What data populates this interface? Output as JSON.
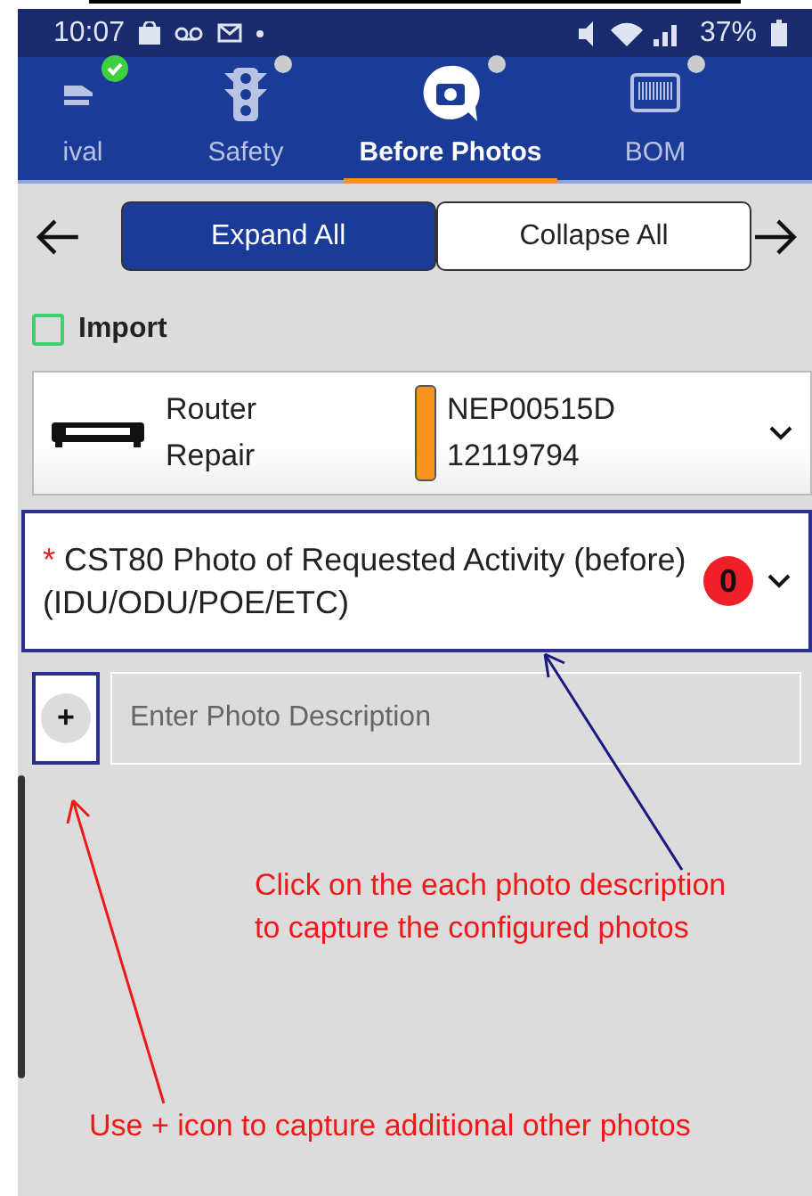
{
  "status_bar": {
    "time": "10:07",
    "battery": "37%"
  },
  "tabs": [
    {
      "label": "ival",
      "selected": false,
      "done": true,
      "kind": "arrival"
    },
    {
      "label": "Safety",
      "selected": false,
      "done": false,
      "kind": "traffic"
    },
    {
      "label": "Before Photos",
      "selected": true,
      "done": false,
      "kind": "camera"
    },
    {
      "label": "BOM",
      "selected": false,
      "done": false,
      "kind": "barcode"
    }
  ],
  "buttons": [
    {
      "label": "Expand All",
      "selected": true
    },
    {
      "label": "Collapse All",
      "selected": false
    }
  ],
  "import": {
    "label": "Import",
    "checked": false
  },
  "device": {
    "name": "Router\nRepair",
    "serial": "NEP00515D",
    "number": "12119794",
    "color": "#f7931e"
  },
  "photo_item": {
    "required_mark": "*",
    "title": "CST80 Photo of Requested Activity (before) (IDU/ODU/POE/ETC)",
    "count": "0"
  },
  "add_photo": {
    "button": "+",
    "placeholder": "Enter Photo Description"
  },
  "annotations": [
    "Click on the each photo description\nto capture the configured photos",
    "Use + icon to capture additional other photos"
  ]
}
